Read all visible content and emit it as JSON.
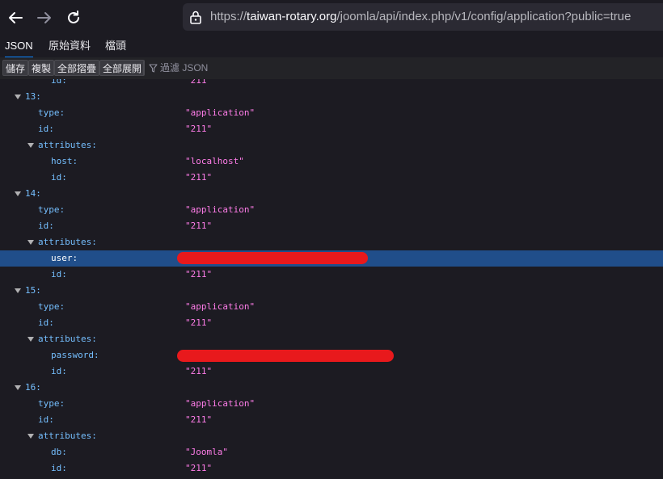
{
  "browser": {
    "url_prefix": "https://",
    "url_domain": "taiwan-rotary.org",
    "url_path": "/joomla/api/index.php/v1/config/application?public=true",
    "icons": [
      "back-arrow-icon",
      "forward-arrow-icon",
      "reload-icon",
      "lock-icon"
    ]
  },
  "viewer": {
    "tabs": [
      "JSON",
      "原始資料",
      "檔頭"
    ],
    "active_tab": "JSON",
    "toolbar": {
      "save": "儲存",
      "copy": "複製",
      "collapse_all": "全部摺疊",
      "expand_all": "全部展開",
      "filter_placeholder": "過濾 JSON"
    }
  },
  "json_rows": [
    {
      "key": "id:",
      "value": "\"211\""
    },
    {
      "key": "13:",
      "value": ""
    },
    {
      "key": "type:",
      "value": "\"application\""
    },
    {
      "key": "id:",
      "value": "\"211\""
    },
    {
      "key": "attributes:",
      "value": ""
    },
    {
      "key": "host:",
      "value": "\"localhost\""
    },
    {
      "key": "id:",
      "value": "\"211\""
    },
    {
      "key": "14:",
      "value": ""
    },
    {
      "key": "type:",
      "value": "\"application\""
    },
    {
      "key": "id:",
      "value": "\"211\""
    },
    {
      "key": "attributes:",
      "value": ""
    },
    {
      "key": "user:",
      "value": ""
    },
    {
      "key": "id:",
      "value": "\"211\""
    },
    {
      "key": "15:",
      "value": ""
    },
    {
      "key": "type:",
      "value": "\"application\""
    },
    {
      "key": "id:",
      "value": "\"211\""
    },
    {
      "key": "attributes:",
      "value": ""
    },
    {
      "key": "password:",
      "value": ""
    },
    {
      "key": "id:",
      "value": "\"211\""
    },
    {
      "key": "16:",
      "value": ""
    },
    {
      "key": "type:",
      "value": "\"application\""
    },
    {
      "key": "id:",
      "value": "\"211\""
    },
    {
      "key": "attributes:",
      "value": ""
    },
    {
      "key": "db:",
      "value": "\"Joomla\""
    },
    {
      "key": "id:",
      "value": "\"211\""
    }
  ],
  "colors": {
    "key": "#75bfff",
    "string_value": "#ff7de9",
    "selected_row": "#204e8a",
    "redaction": "#e8191c",
    "accent": "#0a84ff"
  }
}
